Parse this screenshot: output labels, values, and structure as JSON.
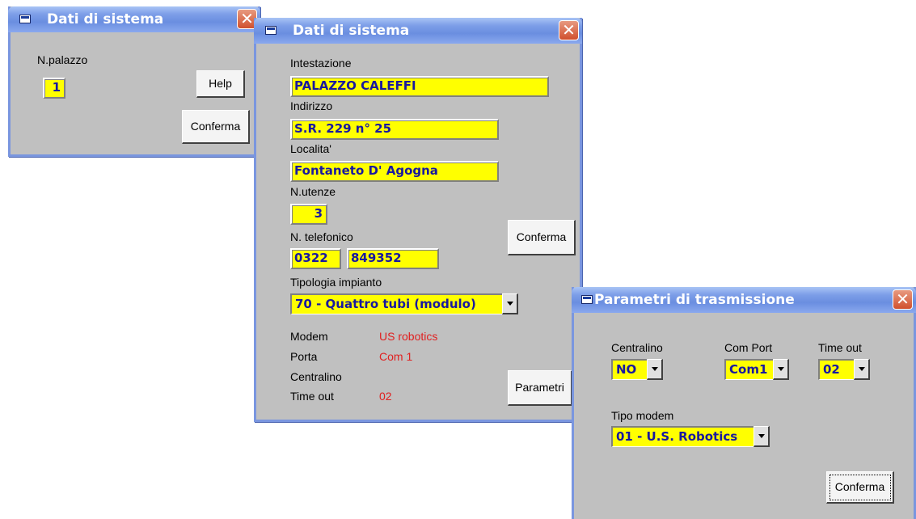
{
  "win1": {
    "title": "Dati di sistema",
    "close": "✕",
    "palazzo_label": "N.palazzo",
    "palazzo_value": "1",
    "help": "Help",
    "conferma": "Conferma"
  },
  "win2": {
    "title": "Dati di sistema",
    "close": "✕",
    "intestazione_label": "Intestazione",
    "intestazione_value": "PALAZZO CALEFFI",
    "indirizzo_label": "Indirizzo",
    "indirizzo_value": "S.R. 229 n° 25",
    "localita_label": "Localita'",
    "localita_value": "Fontaneto D' Agogna",
    "utenze_label": "N.utenze",
    "utenze_value": "3",
    "telefono_label": "N. telefonico",
    "telefono_prefix": "0322",
    "telefono_number": "849352",
    "conferma": "Conferma",
    "tipologia_label": "Tipologia impianto",
    "tipologia_value": "70 - Quattro tubi (modulo)",
    "info": {
      "modem_label": "Modem",
      "modem_value": "US robotics",
      "porta_label": "Porta",
      "porta_value": "Com 1",
      "centralino_label": "Centralino",
      "centralino_value": "",
      "timeout_label": "Time out",
      "timeout_value": "02"
    },
    "parametri": "Parametri"
  },
  "win3": {
    "title": "Parametri di trasmissione",
    "close": "✕",
    "centralino_label": "Centralino",
    "centralino_value": "NO",
    "comport_label": "Com  Port",
    "comport_value": "Com1",
    "timeout_label": "Time out",
    "timeout_value": "02",
    "tipomodem_label": "Tipo modem",
    "tipomodem_value": "01 - U.S. Robotics",
    "conferma": "Conferma"
  },
  "colors": {
    "field_bg": "#ffff00",
    "field_text": "#1818a0",
    "info_value": "#e02020",
    "window_bg": "#c0c0c0",
    "title_bar": "#7d9ee8"
  }
}
